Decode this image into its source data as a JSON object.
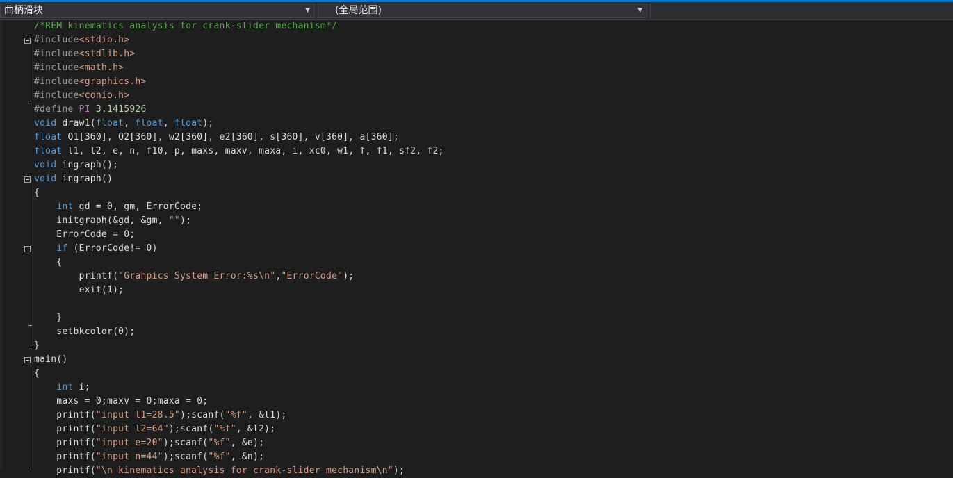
{
  "navbar": {
    "scope_label": "曲柄滑块",
    "member_label": "(全局范围)"
  },
  "lines": [
    {
      "tokens": [
        {
          "t": "/*REM kinematics analysis for crank-slider mechanism*/",
          "c": "comment"
        }
      ]
    },
    {
      "tokens": [
        {
          "t": "#include",
          "c": "pre"
        },
        {
          "t": "<stdio.h>",
          "c": "inc"
        }
      ]
    },
    {
      "tokens": [
        {
          "t": "#include",
          "c": "pre"
        },
        {
          "t": "<stdlib.h>",
          "c": "inc"
        }
      ]
    },
    {
      "tokens": [
        {
          "t": "#include",
          "c": "pre"
        },
        {
          "t": "<math.h>",
          "c": "inc"
        }
      ]
    },
    {
      "tokens": [
        {
          "t": "#include",
          "c": "pre"
        },
        {
          "t": "<graphics.h>",
          "c": "inc"
        }
      ]
    },
    {
      "tokens": [
        {
          "t": "#include",
          "c": "pre"
        },
        {
          "t": "<conio.h>",
          "c": "inc"
        }
      ]
    },
    {
      "tokens": [
        {
          "t": "#define ",
          "c": "pre"
        },
        {
          "t": "PI",
          "c": "macro"
        },
        {
          "t": " 3.1415926",
          "c": "num"
        }
      ]
    },
    {
      "tokens": [
        {
          "t": "void",
          "c": "kw"
        },
        {
          "t": " draw1(",
          "c": "txt"
        },
        {
          "t": "float",
          "c": "kw"
        },
        {
          "t": ", ",
          "c": "txt"
        },
        {
          "t": "float",
          "c": "kw"
        },
        {
          "t": ", ",
          "c": "txt"
        },
        {
          "t": "float",
          "c": "kw"
        },
        {
          "t": ");",
          "c": "txt"
        }
      ]
    },
    {
      "tokens": [
        {
          "t": "float",
          "c": "kw"
        },
        {
          "t": " Q1[360], Q2[360], w2[360], e2[360], s[360], v[360], a[360];",
          "c": "txt"
        }
      ]
    },
    {
      "tokens": [
        {
          "t": "float",
          "c": "kw"
        },
        {
          "t": " l1, l2, e, n, f10, p, maxs, maxv, maxa, i, xc0, w1, f, f1, sf2, f2;",
          "c": "txt"
        }
      ]
    },
    {
      "tokens": [
        {
          "t": "void",
          "c": "kw"
        },
        {
          "t": " ingraph();",
          "c": "txt"
        }
      ]
    },
    {
      "tokens": [
        {
          "t": "void",
          "c": "kw"
        },
        {
          "t": " ingraph()",
          "c": "txt"
        }
      ]
    },
    {
      "tokens": [
        {
          "t": "{",
          "c": "txt"
        }
      ]
    },
    {
      "tokens": [
        {
          "t": "    ",
          "c": "txt"
        },
        {
          "t": "int",
          "c": "kw"
        },
        {
          "t": " gd = 0, gm, ErrorCode;",
          "c": "txt"
        }
      ]
    },
    {
      "tokens": [
        {
          "t": "    initgraph(&gd, &gm, ",
          "c": "txt"
        },
        {
          "t": "\"\"",
          "c": "str"
        },
        {
          "t": ");",
          "c": "txt"
        }
      ]
    },
    {
      "tokens": [
        {
          "t": "    ErrorCode = 0;",
          "c": "txt"
        }
      ]
    },
    {
      "tokens": [
        {
          "t": "    ",
          "c": "txt"
        },
        {
          "t": "if",
          "c": "kw"
        },
        {
          "t": " (ErrorCode!= 0)",
          "c": "txt"
        }
      ]
    },
    {
      "tokens": [
        {
          "t": "    {",
          "c": "txt"
        }
      ]
    },
    {
      "tokens": [
        {
          "t": "        printf(",
          "c": "txt"
        },
        {
          "t": "\"Grahpics System Error:%s\\n\"",
          "c": "str"
        },
        {
          "t": ",",
          "c": "txt"
        },
        {
          "t": "\"ErrorCode\"",
          "c": "str"
        },
        {
          "t": ");",
          "c": "txt"
        }
      ]
    },
    {
      "tokens": [
        {
          "t": "        exit(1);",
          "c": "txt"
        }
      ]
    },
    {
      "tokens": [
        {
          "t": "",
          "c": "txt"
        }
      ]
    },
    {
      "tokens": [
        {
          "t": "    }",
          "c": "txt"
        }
      ]
    },
    {
      "tokens": [
        {
          "t": "    setbkcolor(0);",
          "c": "txt"
        }
      ]
    },
    {
      "tokens": [
        {
          "t": "}",
          "c": "txt"
        }
      ]
    },
    {
      "tokens": [
        {
          "t": "main()",
          "c": "txt"
        }
      ]
    },
    {
      "tokens": [
        {
          "t": "{",
          "c": "txt"
        }
      ]
    },
    {
      "tokens": [
        {
          "t": "    ",
          "c": "txt"
        },
        {
          "t": "int",
          "c": "kw"
        },
        {
          "t": " i;",
          "c": "txt"
        }
      ]
    },
    {
      "tokens": [
        {
          "t": "    maxs = 0;maxv = 0;maxa = 0;",
          "c": "txt"
        }
      ]
    },
    {
      "tokens": [
        {
          "t": "    printf(",
          "c": "txt"
        },
        {
          "t": "\"input l1=28.5\"",
          "c": "str"
        },
        {
          "t": ");scanf(",
          "c": "txt"
        },
        {
          "t": "\"%f\"",
          "c": "str"
        },
        {
          "t": ", &l1);",
          "c": "txt"
        }
      ]
    },
    {
      "tokens": [
        {
          "t": "    printf(",
          "c": "txt"
        },
        {
          "t": "\"input l2=64\"",
          "c": "str"
        },
        {
          "t": ");scanf(",
          "c": "txt"
        },
        {
          "t": "\"%f\"",
          "c": "str"
        },
        {
          "t": ", &l2);",
          "c": "txt"
        }
      ]
    },
    {
      "tokens": [
        {
          "t": "    printf(",
          "c": "txt"
        },
        {
          "t": "\"input e=20\"",
          "c": "str"
        },
        {
          "t": ");scanf(",
          "c": "txt"
        },
        {
          "t": "\"%f\"",
          "c": "str"
        },
        {
          "t": ", &e);",
          "c": "txt"
        }
      ]
    },
    {
      "tokens": [
        {
          "t": "    printf(",
          "c": "txt"
        },
        {
          "t": "\"input n=44\"",
          "c": "str"
        },
        {
          "t": ");scanf(",
          "c": "txt"
        },
        {
          "t": "\"%f\"",
          "c": "str"
        },
        {
          "t": ", &n);",
          "c": "txt"
        }
      ]
    },
    {
      "tokens": [
        {
          "t": "    printf(",
          "c": "txt"
        },
        {
          "t": "\"\\n kinematics analysis for crank-slider mechanism\\n\"",
          "c": "str"
        },
        {
          "t": ");",
          "c": "txt"
        }
      ]
    }
  ],
  "colors": {
    "accent": "#007acc",
    "background": "#1e1e1e",
    "comment": "#57a64a",
    "keyword": "#569cd6",
    "string": "#d69d85",
    "macro": "#bd63c5"
  }
}
